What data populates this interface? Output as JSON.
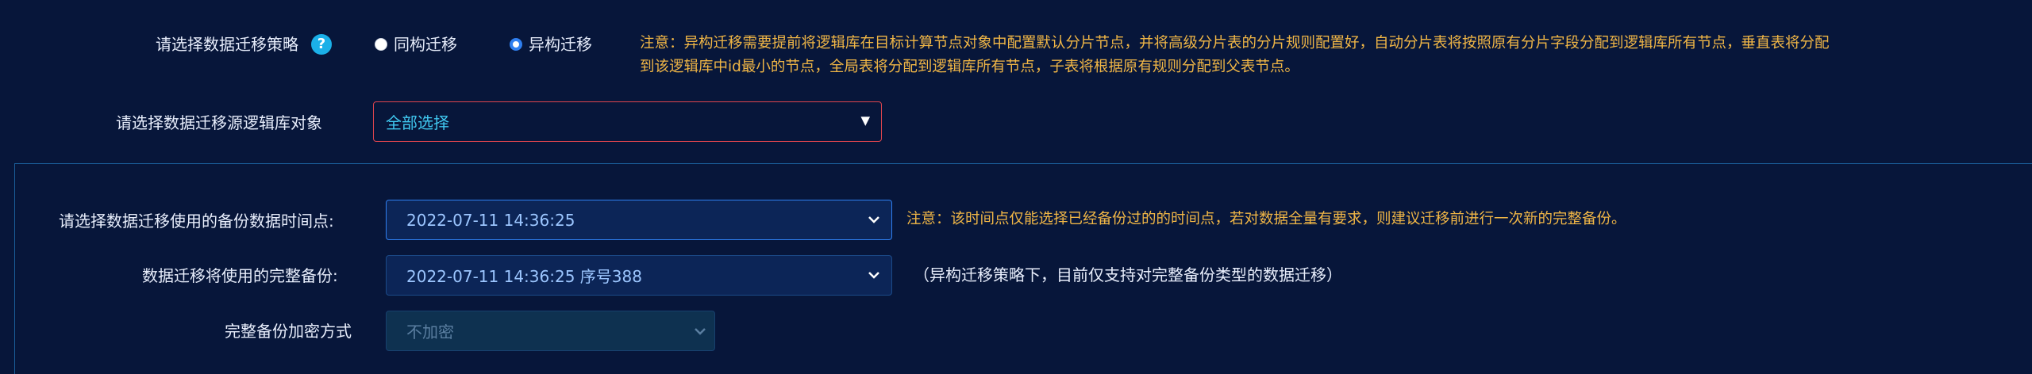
{
  "strategy": {
    "label": "请选择数据迁移策略",
    "help_icon": "?",
    "options": [
      {
        "label": "同构迁移",
        "checked": false
      },
      {
        "label": "异构迁移",
        "checked": true
      }
    ],
    "notice_line1": "注意：异构迁移需要提前将逻辑库在目标计算节点对象中配置默认分片节点，并将高级分片表的分片规则配置好，自动分片表将按照原有分片字段分配到逻辑库所有节点，垂直表将分配",
    "notice_line2": "到该逻辑库中id最小的节点，全局表将分配到逻辑库所有节点，子表将根据原有规则分配到父表节点。"
  },
  "source_db": {
    "label": "请选择数据迁移源逻辑库对象",
    "value": "全部选择",
    "arrow": "▼"
  },
  "backup_time": {
    "label": "请选择数据迁移使用的备份数据时间点:",
    "value": "2022-07-11 14:36:25",
    "notice": "注意：该时间点仅能选择已经备份过的的时间点，若对数据全量有要求，则建议迁移前进行一次新的完整备份。"
  },
  "full_backup": {
    "label": "数据迁移将使用的完整备份:",
    "value": "2022-07-11 14:36:25 序号388",
    "notice": "（异构迁移策略下，目前仅支持对完整备份类型的数据迁移）"
  },
  "encryption": {
    "label": "完整备份加密方式",
    "value": "不加密"
  },
  "colors": {
    "background": "#07163a",
    "notice": "#f0b646",
    "accent": "#2f7ff0",
    "error_border": "#e0454e"
  },
  "icons": {
    "help": "question-circle-icon",
    "dropdown": "caret-down-icon",
    "chevron": "chevron-down-icon"
  }
}
